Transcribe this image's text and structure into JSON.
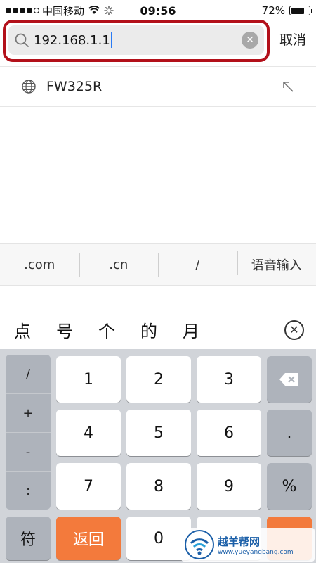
{
  "status_bar": {
    "carrier": "中国移动",
    "time": "09:56",
    "battery": "72%",
    "battery_level": 0.72,
    "signal_dots": 4
  },
  "search": {
    "value": "192.168.1.1",
    "cancel_label": "取消",
    "icons": {
      "search": "search-icon",
      "clear": "clear-icon"
    }
  },
  "suggestion": {
    "label": "FW325R",
    "icons": {
      "globe": "globe-icon",
      "fill": "arrow-up-left-icon"
    }
  },
  "shortcuts": [
    ".com",
    ".cn",
    "/",
    "语音输入"
  ],
  "candidates": [
    "点",
    "号",
    "个",
    "的",
    "月"
  ],
  "keyboard": {
    "symbols": [
      "/",
      "+",
      "-",
      ":"
    ],
    "digits": [
      "1",
      "2",
      "3",
      "4",
      "5",
      "6",
      "7",
      "8",
      "9"
    ],
    "period": ".",
    "percent": "%",
    "symbols_key": "符",
    "back_key": "返回",
    "zero_key": "0"
  },
  "watermark": {
    "text": "越羊帮网",
    "url": "www.yueyangbang.com"
  },
  "colors": {
    "annotation": "#b3101a",
    "caret": "#2a7bf5",
    "back_key": "#f37a3c",
    "watermark": "#1b5fa8"
  }
}
